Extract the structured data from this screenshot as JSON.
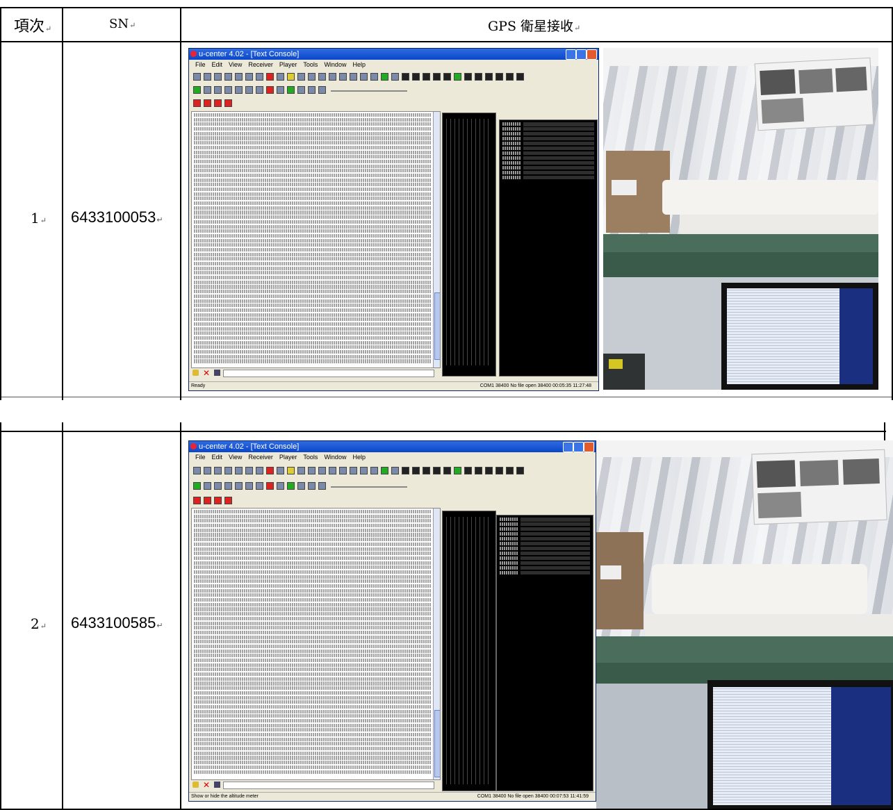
{
  "table": {
    "headers": {
      "item_no": "項次",
      "sn": "SN",
      "gps": "GPS 衛星接收"
    },
    "rows": [
      {
        "item_no": "1",
        "sn": "6433100053",
        "screenshot": {
          "window_title": "u-center 4.02 - [Text Console]",
          "status_left": "Ready",
          "status_right": "COM1 38400 No file open    38400  00:05:35  11:27:48"
        }
      },
      {
        "item_no": "2",
        "sn": "6433100585",
        "screenshot": {
          "window_title": "u-center 4.02 - [Text Console]",
          "status_left": "Show or hide the altitude meter",
          "status_right": "COM1 38400 No file open    38400  00:07:53  11:41:59"
        }
      }
    ]
  },
  "paragraph_mark": "↵",
  "app_menu": [
    "File",
    "Edit",
    "View",
    "Receiver",
    "Player",
    "Tools",
    "Window",
    "Help"
  ]
}
